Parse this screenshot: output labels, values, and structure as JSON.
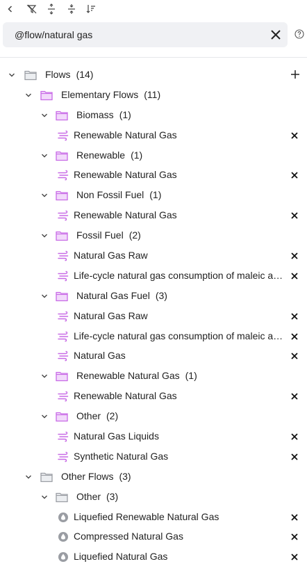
{
  "toolbar": {
    "icons": [
      "back-icon",
      "clear-filter-icon",
      "expand-all-icon",
      "collapse-all-icon",
      "sort-icon"
    ]
  },
  "search": {
    "value": "@flow/natural gas"
  },
  "colors": {
    "purple": "#c86ae6",
    "gray": "#9a9da3"
  },
  "tree": {
    "root": {
      "label": "Flows",
      "count": "(14)"
    },
    "elementary": {
      "label": "Elementary Flows",
      "count": "(11)",
      "groups": [
        {
          "label": "Biomass",
          "count": "(1)",
          "items": [
            "Renewable Natural Gas"
          ]
        },
        {
          "label": "Renewable",
          "count": "(1)",
          "items": [
            "Renewable Natural Gas"
          ]
        },
        {
          "label": "Non Fossil Fuel",
          "count": "(1)",
          "items": [
            "Renewable Natural Gas"
          ]
        },
        {
          "label": "Fossil Fuel",
          "count": "(2)",
          "items": [
            "Natural Gas Raw",
            "Life-cycle natural gas consumption of maleic anhydride"
          ]
        },
        {
          "label": "Natural Gas Fuel",
          "count": "(3)",
          "items": [
            "Natural Gas Raw",
            "Life-cycle natural gas consumption of maleic anhydride",
            "Natural Gas"
          ]
        },
        {
          "label": "Renewable Natural Gas",
          "count": "(1)",
          "items": [
            "Renewable Natural Gas"
          ]
        },
        {
          "label": "Other",
          "count": "(2)",
          "items": [
            "Natural Gas Liquids",
            "Synthetic Natural Gas"
          ]
        }
      ]
    },
    "other": {
      "label": "Other Flows",
      "count": "(3)",
      "groups": [
        {
          "label": "Other",
          "count": "(3)",
          "items": [
            "Liquefied Renewable Natural Gas",
            "Compressed Natural Gas",
            "Liquefied Natural Gas"
          ]
        }
      ]
    }
  }
}
